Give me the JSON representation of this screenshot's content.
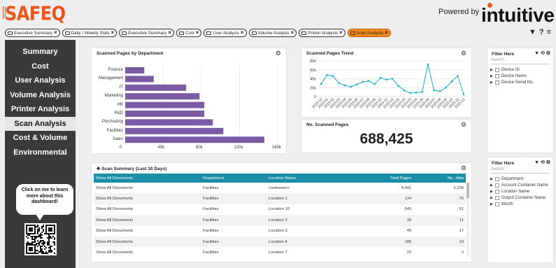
{
  "header": {
    "logo": "SAFEQ",
    "powered_by": "Powered by",
    "brand": "intuitive"
  },
  "tabs": [
    {
      "label": "Executive Summary",
      "active": false
    },
    {
      "label": "Daily / Weekly Stats",
      "active": false
    },
    {
      "label": "Executive Summary",
      "active": false
    },
    {
      "label": "Cost",
      "active": false
    },
    {
      "label": "User Analysis",
      "active": false
    },
    {
      "label": "Volume Analysis",
      "active": false
    },
    {
      "label": "Printer Analysis",
      "active": false
    },
    {
      "label": "Scan Analysis",
      "active": true
    }
  ],
  "top_icons": [
    "filter-icon",
    "help-icon",
    "menu-icon"
  ],
  "sidebar": {
    "items": [
      {
        "label": "Summary",
        "active": false
      },
      {
        "label": "Cost",
        "active": false
      },
      {
        "label": "User Analysis",
        "active": false
      },
      {
        "label": "Volume Analysis",
        "active": false
      },
      {
        "label": "Printer Analysis",
        "active": false
      },
      {
        "label": "Scan Analysis",
        "active": true
      },
      {
        "label": "Cost & Volume",
        "active": false
      },
      {
        "label": "Environmental",
        "active": false
      }
    ],
    "help_bubble": "Click on me to learn more about this dashboard!"
  },
  "panels": {
    "dept_chart_title": "Scanned Pages by Department",
    "trend_title": "Scanned Pages Trend",
    "total_title": "No. Scanned Pages",
    "total_value": "688,425",
    "summary_title": "Scan Summary (Last 30 Days)"
  },
  "chart_data": [
    {
      "type": "bar",
      "orientation": "horizontal",
      "title": "Scanned Pages by Department",
      "categories": [
        "Finance",
        "Management",
        "IT",
        "Marketing",
        "HR",
        "R&D",
        "Purchasing",
        "Facilities",
        "Sales"
      ],
      "values": [
        20000,
        30000,
        64000,
        78000,
        83000,
        83000,
        92000,
        103000,
        146000
      ],
      "xlim": [
        0,
        160000
      ],
      "xticks": [
        "0",
        "40k",
        "80k",
        "120k",
        "160k"
      ],
      "color": "#7b5aa6",
      "grid": true
    },
    {
      "type": "line",
      "title": "Scanned Pages Trend",
      "x": [
        "2023-12",
        "2023-01",
        "2023-02",
        "2023-03",
        "2023-04",
        "2023-05",
        "2023-06",
        "2023-07",
        "2023-08",
        "2023-09",
        "2023-10",
        "2023-11",
        "2023-12",
        "2023-01",
        "2023-02",
        "2023-03",
        "2023-04",
        "2023-05",
        "2023-06",
        "2023-07",
        "2023-08",
        "2023-09",
        "2023-10",
        "2023-11",
        "2023-12"
      ],
      "values": [
        28000,
        48000,
        46000,
        30000,
        25000,
        22000,
        27000,
        33000,
        35000,
        28000,
        42000,
        38000,
        40000,
        24000,
        14000,
        8000,
        9000,
        10000,
        72000,
        14000,
        12000,
        20000,
        34000,
        46000,
        5000
      ],
      "yticks": [
        "0",
        "20k",
        "40k",
        "60k",
        "80k"
      ],
      "ylim": [
        0,
        80000
      ],
      "color": "#2bb5c9",
      "grid": true
    }
  ],
  "table": {
    "columns": [
      "Show All Documents",
      "Department",
      "Location Name",
      "Total Pages",
      "No. Jobs"
    ],
    "rows": [
      [
        "Show All Documents",
        "Facilities",
        "<unknown>",
        "4,041",
        "1,239"
      ],
      [
        "Show All Documents",
        "Facilities",
        "Location 1",
        "134",
        "76"
      ],
      [
        "Show All Documents",
        "Facilities",
        "Location 10",
        "545",
        "61"
      ],
      [
        "Show All Documents",
        "Facilities",
        "Location 2",
        "30",
        "11"
      ],
      [
        "Show All Documents",
        "Facilities",
        "Location 3",
        "45",
        "17"
      ],
      [
        "Show All Documents",
        "Facilities",
        "Location 4",
        "185",
        "10"
      ],
      [
        "Show All Documents",
        "Facilities",
        "Location 7",
        "23",
        "3"
      ]
    ]
  },
  "filters": [
    {
      "title": "Filter Here",
      "search_placeholder": "Search",
      "items": [
        "Device ID",
        "Device Name",
        "Device Serial No."
      ]
    },
    {
      "title": "Filter Here",
      "search_placeholder": "Search",
      "items": [
        "Department",
        "Account Container Name",
        "Location Name",
        "Output Container Name",
        "Month"
      ]
    }
  ]
}
